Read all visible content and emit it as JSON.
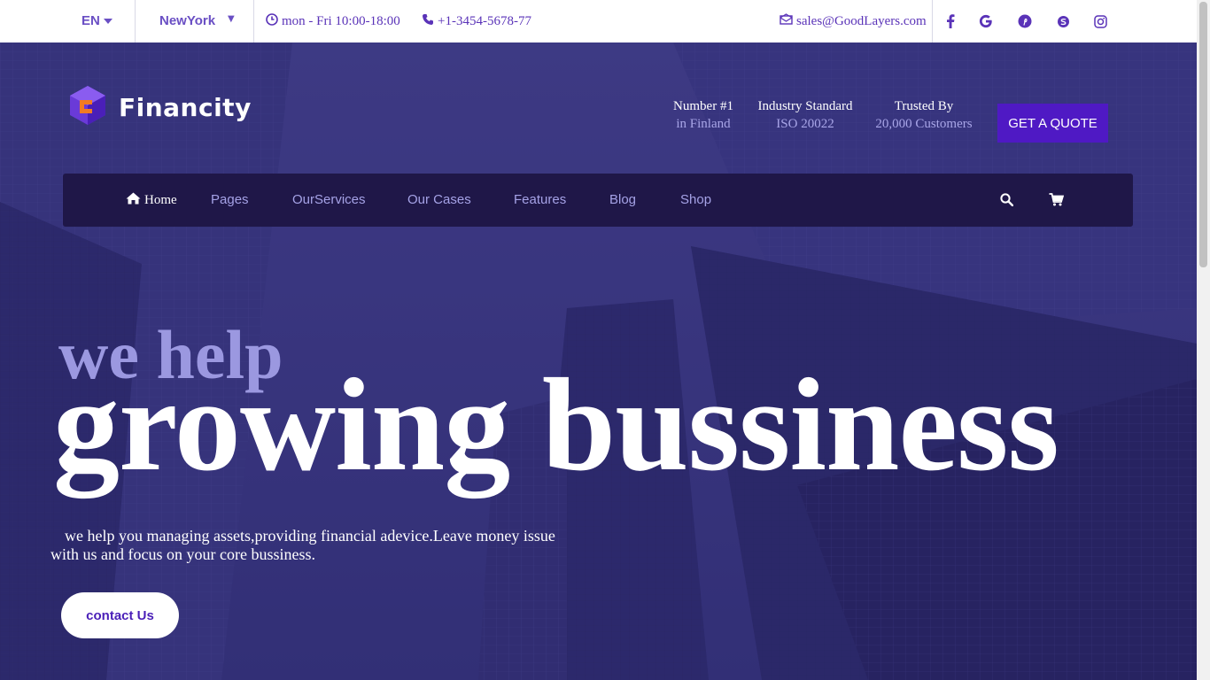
{
  "topbar": {
    "language": "EN",
    "city": "NewYork",
    "hours": "mon - Fri 10:00-18:00",
    "phone": "+1-3454-5678-77",
    "email": "sales@GoodLayers.com",
    "social": [
      "facebook-icon",
      "google-icon",
      "pinterest-icon",
      "skype-icon",
      "instagram-icon"
    ]
  },
  "header": {
    "logo_text": "Financity",
    "stats": [
      {
        "title": "Number #1",
        "sub": "in Finland"
      },
      {
        "title": "Industry Standard",
        "sub": "ISO 20022"
      },
      {
        "title": "Trusted By",
        "sub": "20,000 Customers"
      }
    ],
    "quote_label": "GET A QUOTE"
  },
  "nav": {
    "items": [
      "Home",
      "Pages",
      "OurServices",
      "Our Cases",
      "Features",
      "Blog",
      "Shop"
    ]
  },
  "hero": {
    "line1": "we help",
    "line2": "growing bussiness",
    "description": "we help you managing assets,providing financial adevice.Leave money issue with us and focus on your core bussiness.",
    "cta": "contact Us"
  },
  "colors": {
    "accent": "#4f19c4",
    "nav_bg": "#1f1748",
    "topbar_text": "#5a33b8"
  }
}
